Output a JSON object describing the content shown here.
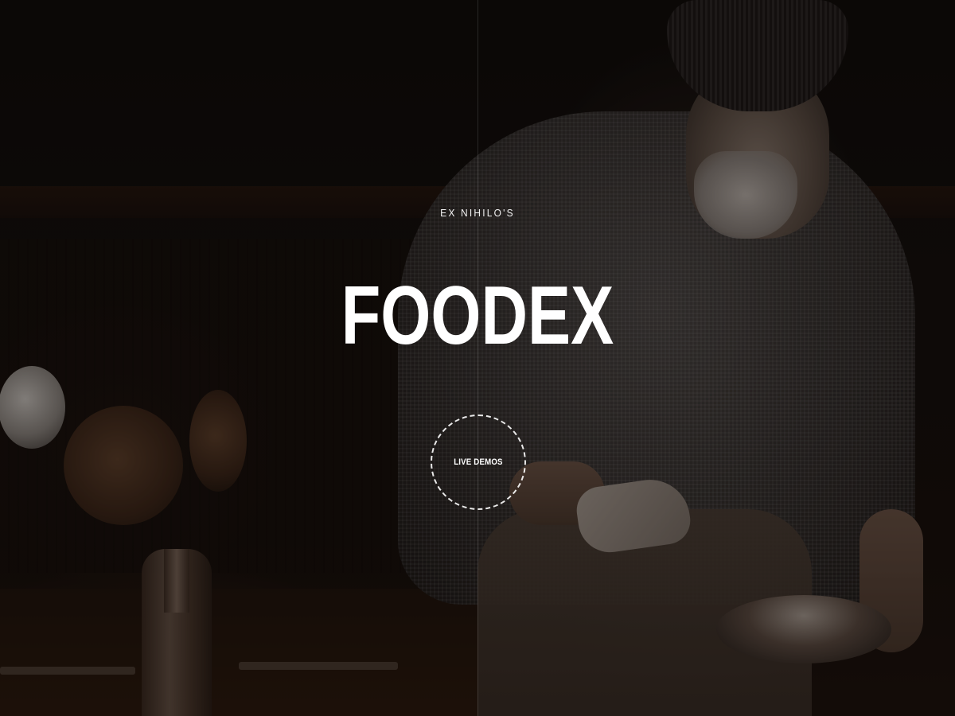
{
  "hero": {
    "subtitle": "EX NIHILO'S",
    "title": "FOODEX",
    "cta_label": "LIVE DEMOS",
    "background_image": "chef-in-kitchen-photo"
  },
  "colors": {
    "text": "#ffffff",
    "background": "#0c0806",
    "cta_border": "#ffffff"
  }
}
